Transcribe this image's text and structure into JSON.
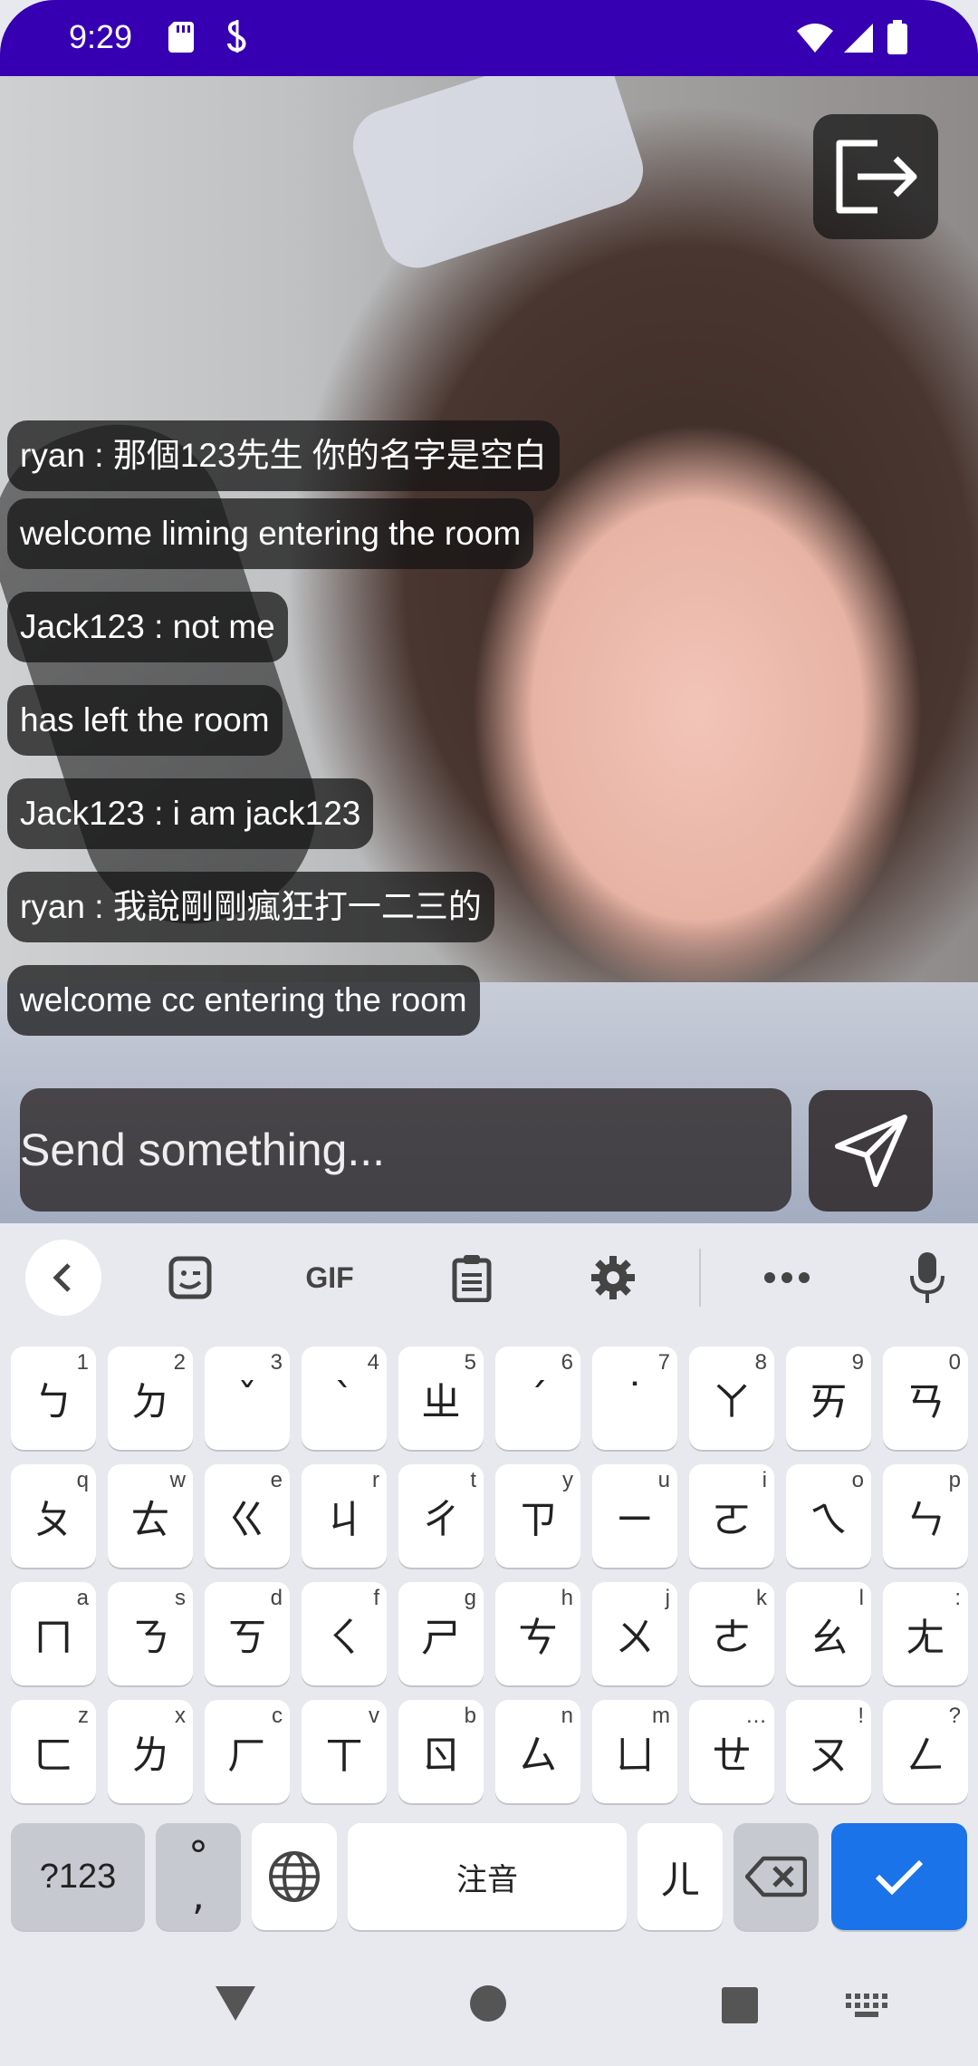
{
  "status": {
    "time": "9:29"
  },
  "chat": {
    "messages": [
      "ryan : 那個123先生 你的名字是空白",
      "welcome liming entering the room",
      "Jack123 : not me",
      " has left the room",
      "Jack123 : i am jack123",
      "ryan : 我說剛剛瘋狂打一二三的",
      "welcome cc entering the room"
    ]
  },
  "input": {
    "placeholder": "Send something..."
  },
  "keyboard": {
    "toolbar": {
      "gif_label": "GIF"
    },
    "rows": [
      [
        {
          "c": "ㄅ",
          "h": "1"
        },
        {
          "c": "ㄉ",
          "h": "2"
        },
        {
          "c": "ˇ",
          "h": "3"
        },
        {
          "c": "ˋ",
          "h": "4"
        },
        {
          "c": "ㄓ",
          "h": "5"
        },
        {
          "c": "ˊ",
          "h": "6"
        },
        {
          "c": "˙",
          "h": "7"
        },
        {
          "c": "ㄚ",
          "h": "8"
        },
        {
          "c": "ㄞ",
          "h": "9"
        },
        {
          "c": "ㄢ",
          "h": "0"
        }
      ],
      [
        {
          "c": "ㄆ",
          "h": "q"
        },
        {
          "c": "ㄊ",
          "h": "w"
        },
        {
          "c": "ㄍ",
          "h": "e"
        },
        {
          "c": "ㄐ",
          "h": "r"
        },
        {
          "c": "ㄔ",
          "h": "t"
        },
        {
          "c": "ㄗ",
          "h": "y"
        },
        {
          "c": "ㄧ",
          "h": "u"
        },
        {
          "c": "ㄛ",
          "h": "i"
        },
        {
          "c": "ㄟ",
          "h": "o"
        },
        {
          "c": "ㄣ",
          "h": "p"
        }
      ],
      [
        {
          "c": "ㄇ",
          "h": "a"
        },
        {
          "c": "ㄋ",
          "h": "s"
        },
        {
          "c": "ㄎ",
          "h": "d"
        },
        {
          "c": "ㄑ",
          "h": "f"
        },
        {
          "c": "ㄕ",
          "h": "g"
        },
        {
          "c": "ㄘ",
          "h": "h"
        },
        {
          "c": "ㄨ",
          "h": "j"
        },
        {
          "c": "ㄜ",
          "h": "k"
        },
        {
          "c": "ㄠ",
          "h": "l"
        },
        {
          "c": "ㄤ",
          "h": ":"
        }
      ],
      [
        {
          "c": "ㄈ",
          "h": "z"
        },
        {
          "c": "ㄌ",
          "h": "x"
        },
        {
          "c": "ㄏ",
          "h": "c"
        },
        {
          "c": "ㄒ",
          "h": "v"
        },
        {
          "c": "ㄖ",
          "h": "b"
        },
        {
          "c": "ㄙ",
          "h": "n"
        },
        {
          "c": "ㄩ",
          "h": "m"
        },
        {
          "c": "ㄝ",
          "h": "…"
        },
        {
          "c": "ㄡ",
          "h": "!"
        },
        {
          "c": "ㄥ",
          "h": "?"
        }
      ]
    ],
    "bottom": {
      "symbols": "?123",
      "punct_top": "°",
      "punct_bottom": ",",
      "space": "注音",
      "er": "ㄦ"
    }
  },
  "colors": {
    "status_bar": "#3600b2",
    "enter_key": "#1a73e8"
  }
}
